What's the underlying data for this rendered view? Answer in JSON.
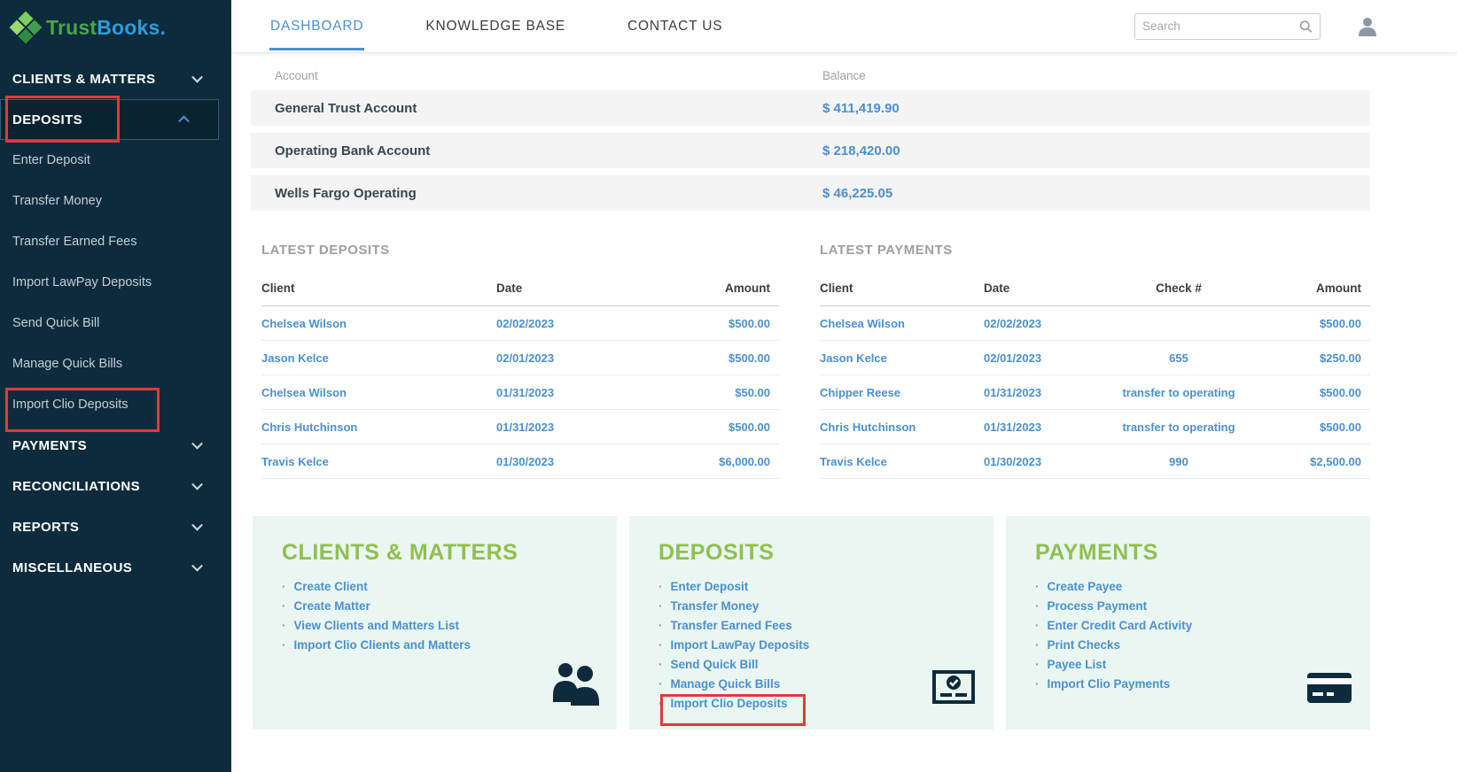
{
  "colors": {
    "sidebar": "#0e2b3d",
    "accent": "#4a90d2",
    "green": "#90bf50",
    "logo-green": "#46a84b",
    "logo-blue": "#2b9cd8",
    "annotation": "#e03a3a",
    "card-bg": "#eaf6f1"
  },
  "sidebar": {
    "logo": {
      "trust": "Trust",
      "books": "Books."
    },
    "items": [
      {
        "label": "CLIENTS & MATTERS"
      },
      {
        "label": "DEPOSITS"
      },
      {
        "label": "PAYMENTS"
      },
      {
        "label": "RECONCILIATIONS"
      },
      {
        "label": "REPORTS"
      },
      {
        "label": "MISCELLANEOUS"
      }
    ],
    "deposit_subitems": [
      "Enter Deposit",
      "Transfer Money",
      "Transfer Earned Fees",
      "Import LawPay Deposits",
      "Send Quick Bill",
      "Manage Quick Bills",
      "Import Clio Deposits"
    ]
  },
  "topnav": {
    "tabs": [
      {
        "label": "DASHBOARD",
        "active": true
      },
      {
        "label": "KNOWLEDGE BASE",
        "active": false
      },
      {
        "label": "CONTACT US",
        "active": false
      }
    ],
    "search_placeholder": "Search",
    "icons": [
      "search-icon",
      "user-icon"
    ]
  },
  "accounts": {
    "headers": {
      "account": "Account",
      "balance": "Balance"
    },
    "rows": [
      {
        "name": "General Trust Account",
        "balance": "$ 411,419.90"
      },
      {
        "name": "Operating Bank Account",
        "balance": "$ 218,420.00"
      },
      {
        "name": "Wells Fargo Operating",
        "balance": "$ 46,225.05"
      }
    ]
  },
  "latest_deposits": {
    "title": "LATEST DEPOSITS",
    "headers": {
      "client": "Client",
      "date": "Date",
      "amount": "Amount"
    },
    "rows": [
      {
        "client": "Chelsea Wilson",
        "date": "02/02/2023",
        "amount": "$500.00"
      },
      {
        "client": "Jason Kelce",
        "date": "02/01/2023",
        "amount": "$500.00"
      },
      {
        "client": "Chelsea Wilson",
        "date": "01/31/2023",
        "amount": "$50.00"
      },
      {
        "client": "Chris Hutchinson",
        "date": "01/31/2023",
        "amount": "$500.00"
      },
      {
        "client": "Travis Kelce",
        "date": "01/30/2023",
        "amount": "$6,000.00"
      }
    ]
  },
  "latest_payments": {
    "title": "LATEST PAYMENTS",
    "headers": {
      "client": "Client",
      "date": "Date",
      "check": "Check #",
      "amount": "Amount"
    },
    "rows": [
      {
        "client": "Chelsea Wilson",
        "date": "02/02/2023",
        "check": "",
        "amount": "$500.00"
      },
      {
        "client": "Jason Kelce",
        "date": "02/01/2023",
        "check": "655",
        "amount": "$250.00"
      },
      {
        "client": "Chipper Reese",
        "date": "01/31/2023",
        "check": "transfer to operating",
        "amount": "$500.00"
      },
      {
        "client": "Chris Hutchinson",
        "date": "01/31/2023",
        "check": "transfer to operating",
        "amount": "$500.00"
      },
      {
        "client": "Travis Kelce",
        "date": "01/30/2023",
        "check": "990",
        "amount": "$2,500.00"
      }
    ]
  },
  "cards": [
    {
      "title": "CLIENTS & MATTERS",
      "icon": "people-icon",
      "links": [
        "Create Client",
        "Create Matter",
        "View Clients and Matters List",
        "Import Clio Clients and Matters"
      ]
    },
    {
      "title": "DEPOSITS",
      "icon": "money-check-icon",
      "links": [
        "Enter Deposit",
        "Transfer Money",
        "Transfer Earned Fees",
        "Import LawPay Deposits",
        "Send Quick Bill",
        "Manage Quick Bills",
        "Import Clio Deposits"
      ]
    },
    {
      "title": "PAYMENTS",
      "icon": "credit-card-icon",
      "links": [
        "Create Payee",
        "Process Payment",
        "Enter Credit Card Activity",
        "Print Checks",
        "Payee List",
        "Import Clio Payments"
      ]
    }
  ]
}
